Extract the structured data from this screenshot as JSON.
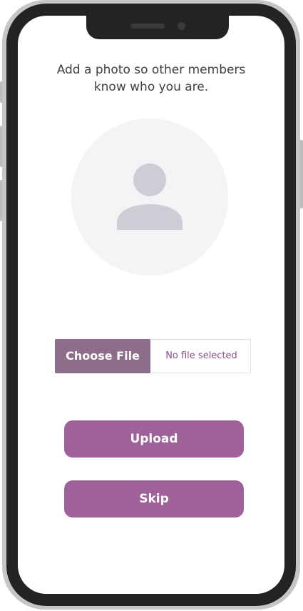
{
  "prompt": {
    "line1": "Add a photo so other members",
    "line2": "know who you are."
  },
  "avatar": {
    "icon": "user-silhouette-icon"
  },
  "file_input": {
    "button_label": "Choose File",
    "status": "No file selected"
  },
  "actions": {
    "upload_label": "Upload",
    "skip_label": "Skip"
  },
  "colors": {
    "accent": "#9f6199",
    "file_button": "#8e6d8a",
    "file_status_text": "#8d4f8a",
    "avatar_bg": "#f4f4f6",
    "avatar_icon": "#cdcdd5",
    "frame": "#232323"
  }
}
